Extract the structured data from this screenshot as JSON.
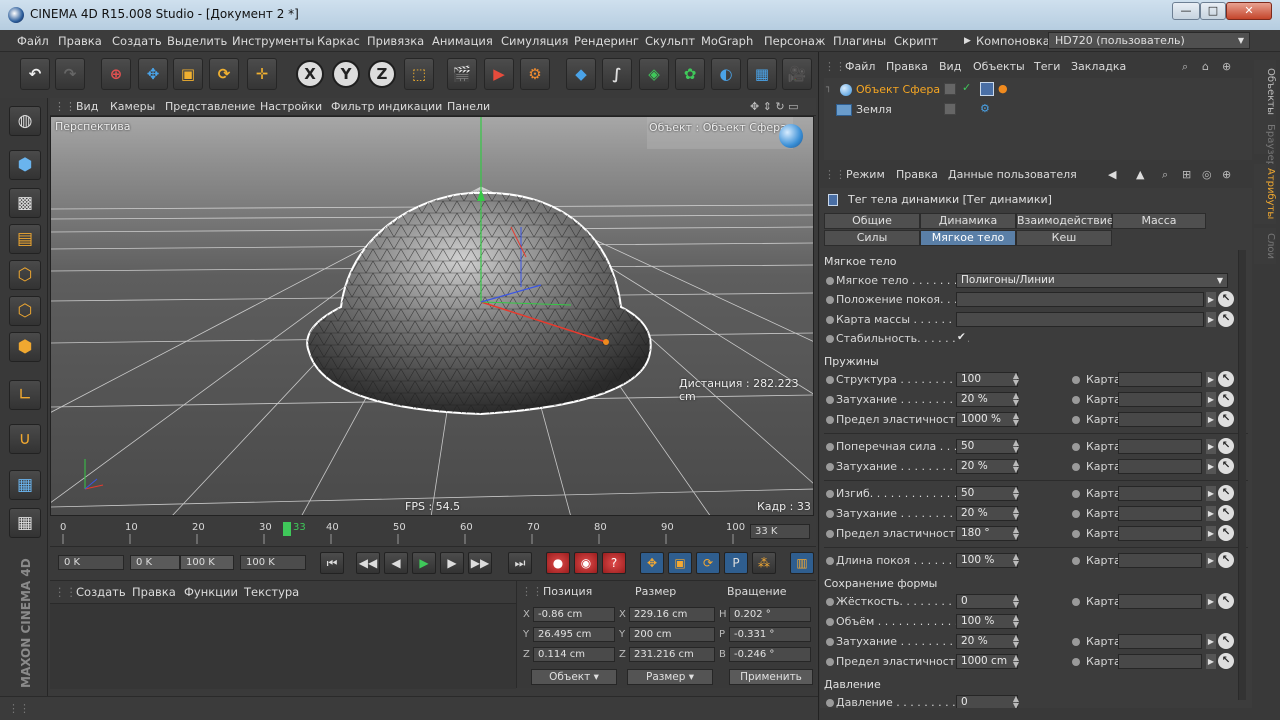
{
  "window": {
    "title": "CINEMA 4D R15.008 Studio - [Документ 2 *]",
    "controls": {
      "minimize": "—",
      "maximize": "□",
      "close": "✕"
    }
  },
  "menubar": {
    "items": [
      "Файл",
      "Правка",
      "Создать",
      "Выделить",
      "Инструменты",
      "Каркас",
      "Привязка",
      "Анимация",
      "Симуляция",
      "Рендеринг",
      "Скульпт",
      "MoGraph",
      "Персонаж",
      "Плагины",
      "Скрипт"
    ],
    "layout_label": "Компоновка",
    "layout_value": "HD720 (пользователь)"
  },
  "viewport": {
    "menu": [
      "Вид",
      "Камеры",
      "Представление",
      "Настройки",
      "Фильтр индикации",
      "Панели"
    ],
    "name": "Перспектива",
    "object_label": "Объект : Объект Сфера",
    "distance": "Дистанция : 282.223 cm",
    "fps": "FPS : 54.5",
    "frame": "Кадр : 33"
  },
  "timeline": {
    "ticks": [
      "0",
      "10",
      "20",
      "30",
      "40",
      "50",
      "60",
      "70",
      "80",
      "90",
      "100"
    ],
    "current": "33",
    "current_field": "33 K"
  },
  "playback": {
    "start": "0 K",
    "range_start": "0 K",
    "range_end": "100 K",
    "end": "100 K"
  },
  "material_manager": {
    "menu": [
      "Создать",
      "Правка",
      "Функции",
      "Текстура"
    ]
  },
  "coordinates": {
    "headers": [
      "Позиция",
      "Размер",
      "Вращение"
    ],
    "rows": [
      {
        "axis": "X",
        "pos": "-0.86 cm",
        "saxis": "X",
        "size": "229.16 cm",
        "raxis": "H",
        "rot": "0.202 °"
      },
      {
        "axis": "Y",
        "pos": "26.495 cm",
        "saxis": "Y",
        "size": "200 cm",
        "raxis": "P",
        "rot": "-0.331 °"
      },
      {
        "axis": "Z",
        "pos": "0.114 cm",
        "saxis": "Z",
        "size": "231.216 cm",
        "raxis": "B",
        "rot": "-0.246 °"
      }
    ],
    "mode": "Объект",
    "size_mode": "Размер",
    "apply": "Применить"
  },
  "logo": "MAXON CINEMA 4D",
  "object_manager": {
    "menu": [
      "Файл",
      "Правка",
      "Вид",
      "Объекты",
      "Теги",
      "Закладка"
    ],
    "objects": [
      {
        "name": "Объект Сфера",
        "selected": true
      },
      {
        "name": "Земля",
        "selected": false
      }
    ],
    "side_tabs": [
      "Объекты",
      "Браузер"
    ]
  },
  "attributes": {
    "menu": [
      "Режим",
      "Правка",
      "Данные пользователя"
    ],
    "tag_title": "Тег тела динамики [Тег динамики]",
    "tabs_row1": [
      "Общие",
      "Динамика",
      "Взаимодействие",
      "Масса"
    ],
    "tabs_row2": [
      "Силы",
      "Мягкое тело",
      "Кеш"
    ],
    "active_tabs": [
      "Динамика",
      "Мягкое тело"
    ],
    "side_tabs": [
      "Атрибуты",
      "Слои"
    ],
    "softbody_section": "Мягкое тело",
    "softbody": [
      {
        "label": "Мягкое тело . . . . . . . .",
        "value": "Полигоны/Линии"
      },
      {
        "label": "Положение покоя. . . . .",
        "value": ""
      },
      {
        "label": "Карта массы . . . . . . . .",
        "value": ""
      },
      {
        "label": "Стабильность. . . . . . . .",
        "value": "✔"
      }
    ],
    "springs_section": "Пружины",
    "springs": [
      {
        "label": "Структура . . . . . . . . . .",
        "value": "100",
        "map": "Карта"
      },
      {
        "label": "Затухание . . . . . . . . . .",
        "value": "20 %",
        "map": "Карта"
      },
      {
        "label": "Предел эластичности",
        "value": "1000 %",
        "map": "Карта"
      },
      {
        "label": "Поперечная сила . . .",
        "value": "50",
        "map": "Карта"
      },
      {
        "label": "Затухание . . . . . . . . . .",
        "value": "20 %",
        "map": "Карта"
      },
      {
        "label": "Изгиб. . . . . . . . . . . . . .",
        "value": "50",
        "map": "Карта"
      },
      {
        "label": "Затухание . . . . . . . . . .",
        "value": "20 %",
        "map": "Карта"
      },
      {
        "label": "Предел эластичности",
        "value": "180 °",
        "map": "Карта"
      },
      {
        "label": "Длина покоя . . . . . . .",
        "value": "100 %",
        "map": "Карта"
      }
    ],
    "shape_section": "Сохранение формы",
    "shape": [
      {
        "label": "Жёсткость. . . . . . . . . .",
        "value": "0",
        "map": "Карта"
      },
      {
        "label": "Объём . . . . . . . . . . . . .",
        "value": "100 %",
        "map": ""
      },
      {
        "label": "Затухание . . . . . . . . . .",
        "value": "20 %",
        "map": "Карта"
      },
      {
        "label": "Предел эластичности",
        "value": "1000 cm",
        "map": "Карта"
      }
    ],
    "pressure_section": "Давление",
    "pressure": [
      {
        "label": "Давление . . . . . . . . . .",
        "value": "0",
        "map": ""
      }
    ]
  }
}
